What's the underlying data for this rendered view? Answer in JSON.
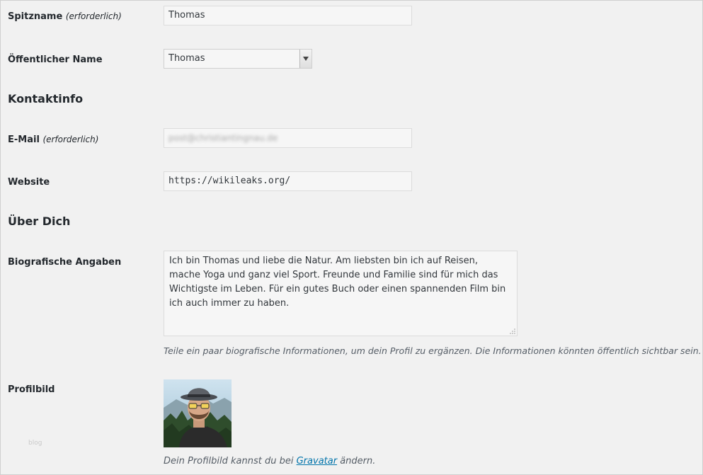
{
  "nickname": {
    "label": "Spitzname",
    "required": "(erforderlich)",
    "value": "Thomas"
  },
  "display_name": {
    "label": "Öffentlicher Name",
    "selected": "Thomas"
  },
  "contact_section": {
    "title": "Kontaktinfo"
  },
  "email": {
    "label": "E-Mail",
    "required": "(erforderlich)",
    "value": "post@christiantingnau.de"
  },
  "website": {
    "label": "Website",
    "value": "https://wikileaks.org/"
  },
  "about_section": {
    "title": "Über Dich"
  },
  "bio": {
    "label": "Biografische Angaben",
    "value": "Ich bin Thomas und liebe die Natur. Am liebsten bin ich auf Reisen, mache Yoga und ganz viel Sport. Freunde und Familie sind für mich das Wichtigste im Leben. Für ein gutes Buch oder einen spannenden Film bin ich auch immer zu haben.",
    "description": "Teile ein paar biografische Informationen, um dein Profil zu ergänzen. Die Informationen könnten öffentlich sichtbar sein."
  },
  "profile_picture": {
    "label": "Profilbild",
    "hint_before": "Dein Profilbild kannst du bei",
    "hint_link": "Gravatar",
    "hint_after": "ändern."
  },
  "watermark": "blog"
}
